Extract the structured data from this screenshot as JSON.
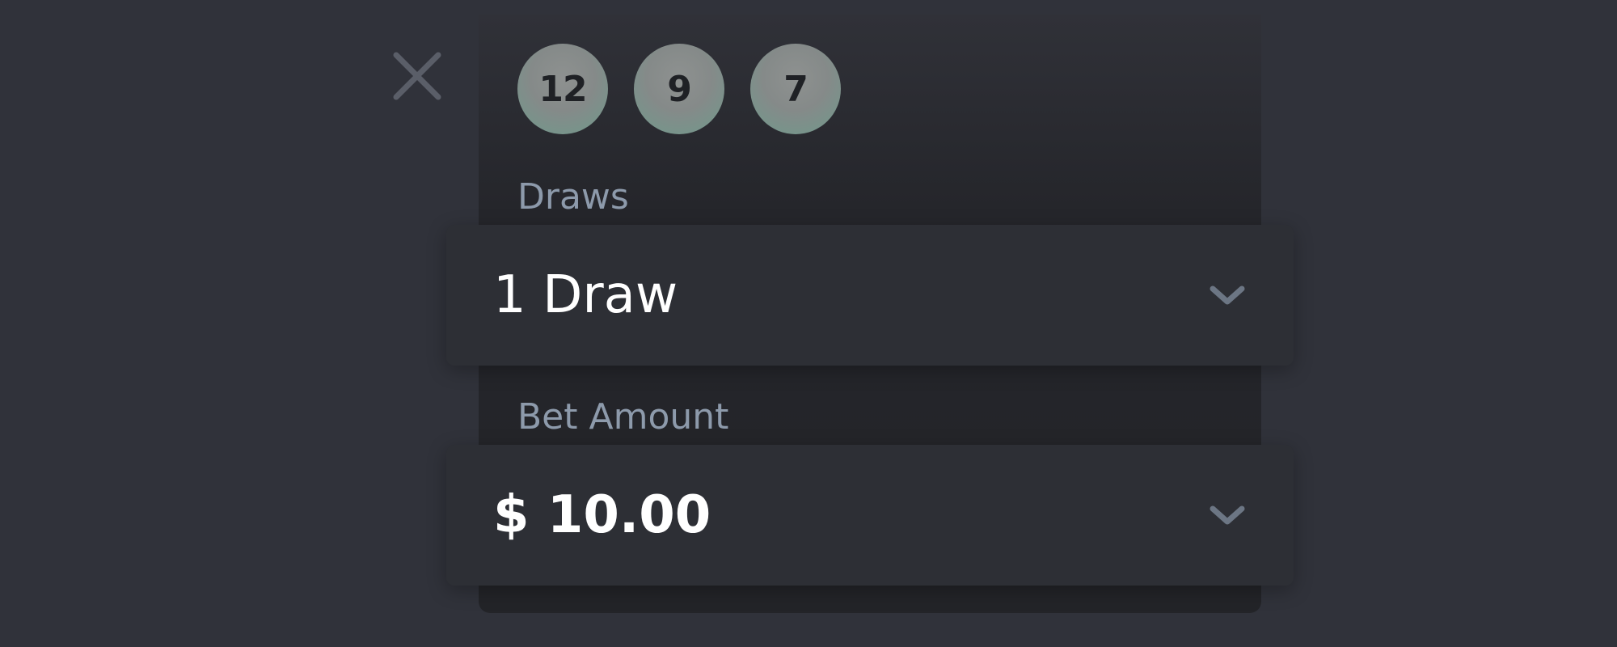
{
  "balls": [
    "12",
    "9",
    "7"
  ],
  "draws": {
    "label": "Draws",
    "selected": "1 Draw"
  },
  "bet": {
    "label": "Bet Amount",
    "selected": "$ 10.00"
  },
  "icons": {
    "close": "close-icon",
    "chevron": "chevron-down-icon"
  },
  "colors": {
    "background": "#30323a",
    "panel": "#232428",
    "label": "#8d9aab",
    "value": "#ffffff",
    "ball": "#858a89",
    "ball_accent": "#6f9a8c",
    "chevron": "#6c7684"
  }
}
